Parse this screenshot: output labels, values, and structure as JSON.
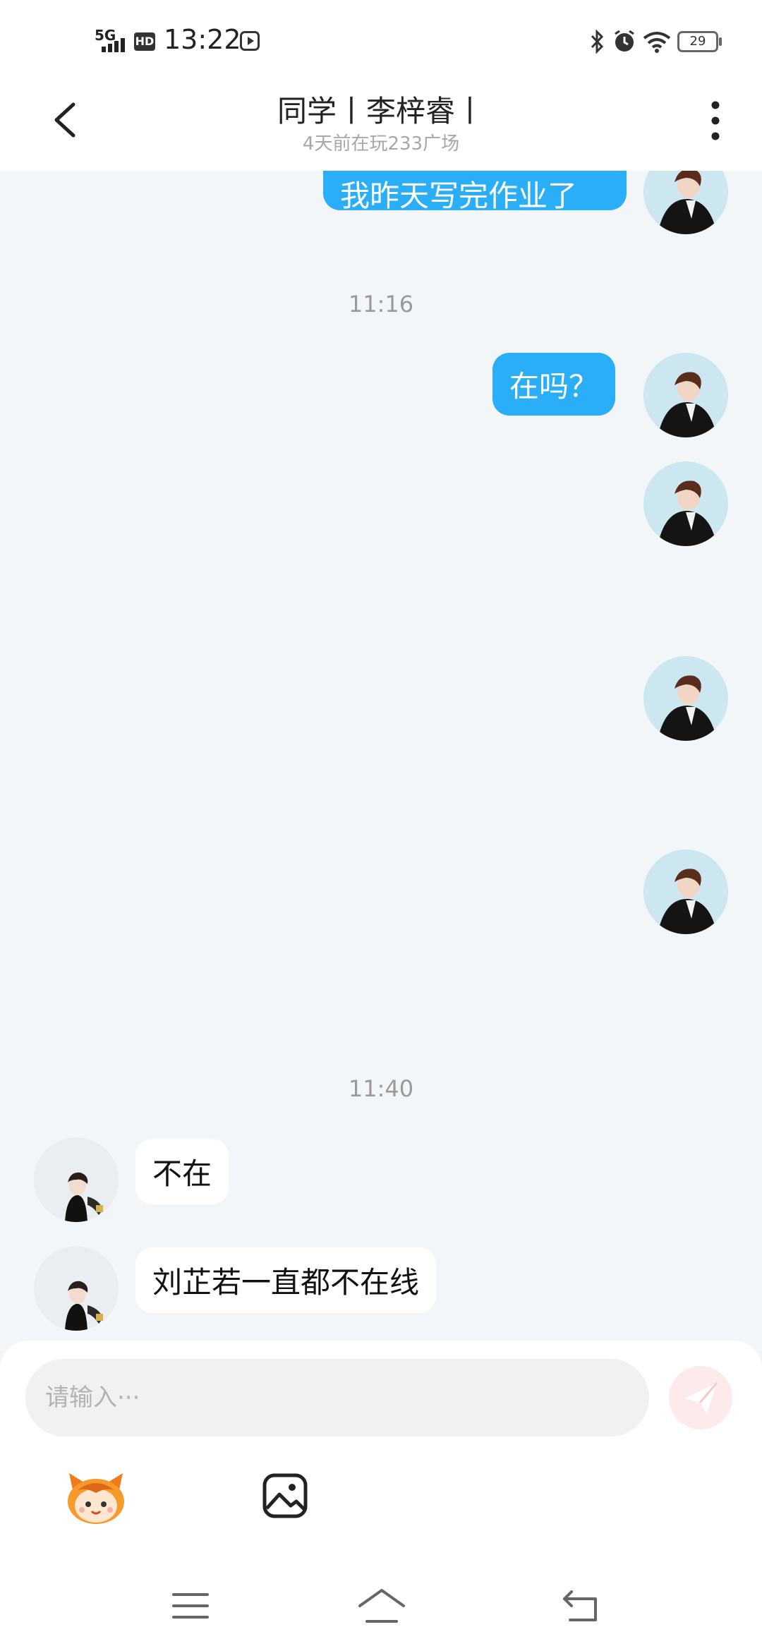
{
  "status_bar": {
    "network": "5G",
    "hd": "HD",
    "time": "13:22",
    "battery": "29"
  },
  "header": {
    "title": "同学丨李梓睿丨",
    "subtitle": "4天前在玩233广场"
  },
  "chat": {
    "partial_message": "我昨天写完作业了",
    "time_1": "11:16",
    "message_zaima": "在吗？",
    "time_2": "11:40",
    "incoming_1": "不在",
    "incoming_2": "刘芷若一直都不在线"
  },
  "composer": {
    "placeholder": "请输入···"
  },
  "icons": {
    "back": "back-arrow-icon",
    "more": "more-vertical-icon",
    "send": "send-icon",
    "emoji": "mascot-emoji-icon",
    "image": "image-icon",
    "nav_menu": "menu-icon",
    "nav_home": "home-icon",
    "nav_back": "back-icon"
  },
  "colors": {
    "outgoing_bubble": "#29aef7",
    "chat_background": "#f3f6f9",
    "send_button": "#fdeaea"
  }
}
